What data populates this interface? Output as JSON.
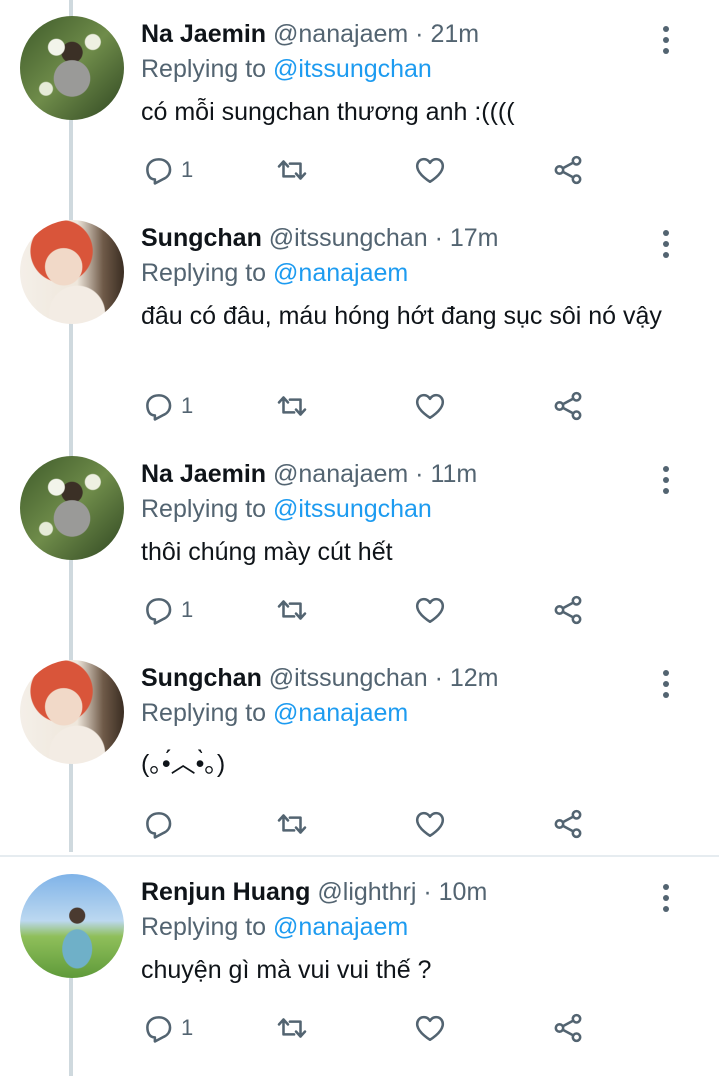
{
  "tweets": [
    {
      "name": "Na Jaemin",
      "handle": "@nanajaem",
      "sep": "·",
      "time": "21m",
      "replying_prefix": "Replying to",
      "replying_handle": "@itssungchan",
      "text": "có mỗi sungchan thương anh :((((",
      "reply_count": "1",
      "avatar": "jaemin"
    },
    {
      "name": "Sungchan",
      "handle": "@itssungchan",
      "sep": "·",
      "time": "17m",
      "replying_prefix": "Replying to",
      "replying_handle": "@nanajaem",
      "text": "đâu có đâu, máu hóng hớt đang sục sôi nó vậy",
      "reply_count": "1",
      "avatar": "sungchan"
    },
    {
      "name": "Na Jaemin",
      "handle": "@nanajaem",
      "sep": "·",
      "time": "11m",
      "replying_prefix": "Replying to",
      "replying_handle": "@itssungchan",
      "text": "thôi chúng mày cút hết",
      "reply_count": "1",
      "avatar": "jaemin"
    },
    {
      "name": "Sungchan",
      "handle": "@itssungchan",
      "sep": "·",
      "time": "12m",
      "replying_prefix": "Replying to",
      "replying_handle": "@nanajaem",
      "text": "(｡•́︿•̀｡)",
      "reply_count": "",
      "avatar": "sungchan"
    },
    {
      "name": "Renjun Huang",
      "handle": "@lighthrj",
      "sep": "·",
      "time": "10m",
      "replying_prefix": "Replying to",
      "replying_handle": "@nanajaem",
      "text": "chuyện gì mà vui vui thế ?",
      "reply_count": "1",
      "avatar": "renjun"
    }
  ],
  "icons": {
    "reply": "reply-icon",
    "retweet": "retweet-icon",
    "like": "heart-icon",
    "share": "share-icon",
    "more": "more-vertical-icon"
  },
  "colors": {
    "link": "#1d9bf0",
    "secondary": "#536471",
    "text": "#0f1419",
    "thread_line": "#cfd9de"
  }
}
